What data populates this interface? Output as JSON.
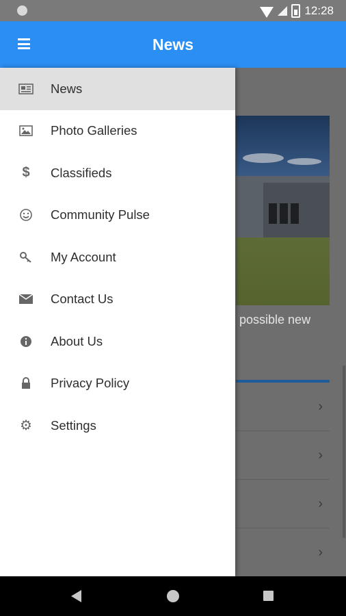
{
  "status_bar": {
    "time": "12:28"
  },
  "app_bar": {
    "title": "News"
  },
  "background_content": {
    "caption": "possible new",
    "list_rows": [
      {
        "chevron": "›"
      },
      {
        "chevron": "›"
      },
      {
        "chevron": "›"
      },
      {
        "chevron": "›"
      }
    ]
  },
  "drawer": {
    "items": [
      {
        "label": "News",
        "icon": "newspaper-icon",
        "active": true
      },
      {
        "label": "Photo Galleries",
        "icon": "image-icon",
        "active": false
      },
      {
        "label": "Classifieds",
        "icon": "dollar-icon",
        "active": false
      },
      {
        "label": "Community Pulse",
        "icon": "smiley-icon",
        "active": false
      },
      {
        "label": "My Account",
        "icon": "key-icon",
        "active": false
      },
      {
        "label": "Contact Us",
        "icon": "envelope-icon",
        "active": false
      },
      {
        "label": "About Us",
        "icon": "info-icon",
        "active": false
      },
      {
        "label": "Privacy Policy",
        "icon": "lock-icon",
        "active": false
      },
      {
        "label": "Settings",
        "icon": "gear-icon",
        "active": false
      }
    ]
  },
  "colors": {
    "app_bar": "#2b8ef2",
    "drawer_active": "#e0e0e0",
    "accent_line": "#1f5c9c"
  }
}
